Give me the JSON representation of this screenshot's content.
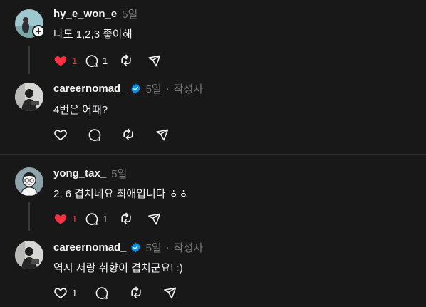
{
  "posts": [
    {
      "username": "hy_e_won_e",
      "time": "5일",
      "text": "나도 1,2,3 좋아해",
      "liked": true,
      "like_count": "1",
      "reply_count": "1"
    },
    {
      "username": "careernomad_",
      "time": "5일",
      "author_label": "작성자",
      "separator": "·",
      "text": "4번은 어때?"
    },
    {
      "username": "yong_tax_",
      "time": "5일",
      "text": "2, 6 겹치네요 최애입니다 ㅎㅎ",
      "liked": true,
      "like_count": "1",
      "reply_count": "1"
    },
    {
      "username": "careernomad_",
      "time": "5일",
      "author_label": "작성자",
      "separator": "·",
      "text": "역시 저랑 취향이 겹치군요! :)",
      "like_count": "1"
    }
  ],
  "colors": {
    "background": "#181818",
    "text": "#f3f5f7",
    "muted": "#777777",
    "like_red": "#ff3040",
    "verified_blue": "#0095f6"
  },
  "icons": [
    "heart-icon",
    "comment-icon",
    "repost-icon",
    "share-icon",
    "verified-badge-icon",
    "follow-plus-icon"
  ]
}
